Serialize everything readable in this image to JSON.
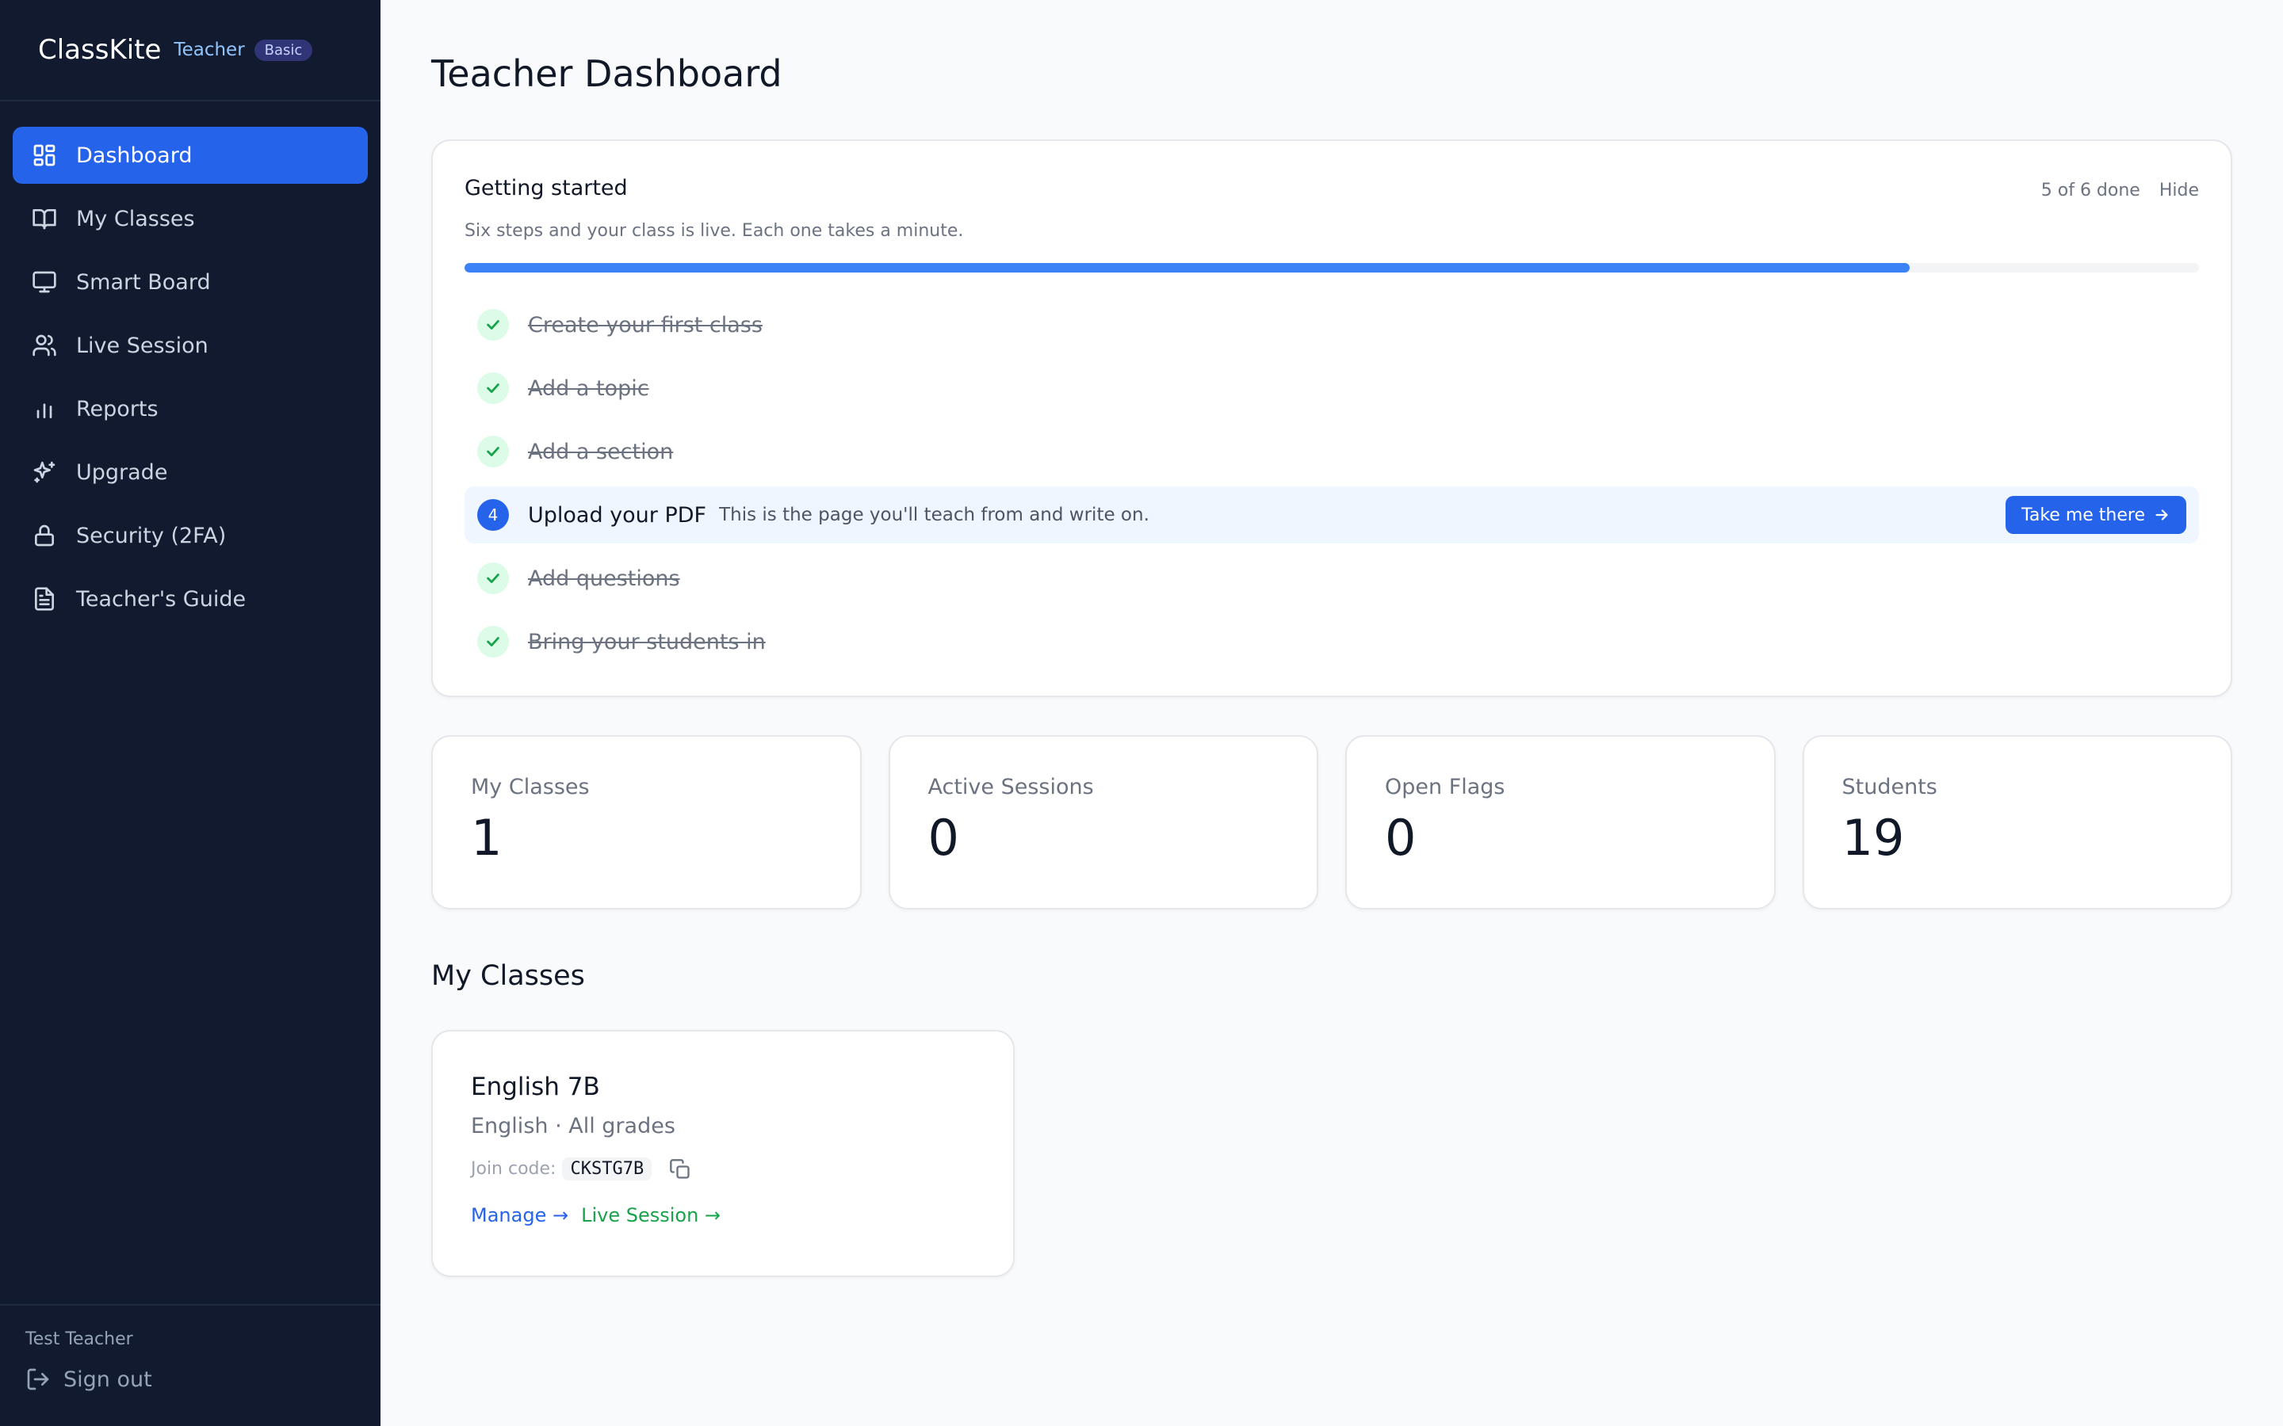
{
  "brand": {
    "name": "ClassKite",
    "role": "Teacher",
    "plan": "Basic"
  },
  "sidebar": {
    "items": [
      {
        "label": "Dashboard",
        "icon": "dashboard-icon",
        "active": true
      },
      {
        "label": "My Classes",
        "icon": "book-open-icon"
      },
      {
        "label": "Smart Board",
        "icon": "monitor-icon"
      },
      {
        "label": "Live Session",
        "icon": "users-icon"
      },
      {
        "label": "Reports",
        "icon": "bar-chart-icon"
      },
      {
        "label": "Upgrade",
        "icon": "sparkles-icon"
      },
      {
        "label": "Security (2FA)",
        "icon": "lock-icon"
      },
      {
        "label": "Teacher's Guide",
        "icon": "file-text-icon"
      }
    ],
    "user_name": "Test Teacher",
    "signout_label": "Sign out"
  },
  "page": {
    "title": "Teacher Dashboard"
  },
  "getting_started": {
    "title": "Getting started",
    "subtitle": "Six steps and your class is live. Each one takes a minute.",
    "progress_text": "5 of 6 done",
    "progress_fraction": 0.8333,
    "hide_label": "Hide",
    "steps": [
      {
        "label": "Create your first class",
        "done": true
      },
      {
        "label": "Add a topic",
        "done": true
      },
      {
        "label": "Add a section",
        "done": true
      },
      {
        "label": "Upload your PDF",
        "done": false,
        "number": "4",
        "description": "This is the page you'll teach from and write on.",
        "action_label": "Take me there"
      },
      {
        "label": "Add questions",
        "done": true
      },
      {
        "label": "Bring your students in",
        "done": true
      }
    ]
  },
  "stats": [
    {
      "label": "My Classes",
      "value": "1"
    },
    {
      "label": "Active Sessions",
      "value": "0"
    },
    {
      "label": "Open Flags",
      "value": "0"
    },
    {
      "label": "Students",
      "value": "19"
    }
  ],
  "my_classes": {
    "title": "My Classes",
    "classes": [
      {
        "name": "English 7B",
        "meta": "English · All grades",
        "join_label": "Join code:",
        "join_code": "CKSTG7B",
        "manage_label": "Manage →",
        "live_label": "Live Session →"
      }
    ]
  },
  "colors": {
    "sidebar_bg": "#111a2e",
    "accent": "#2563eb",
    "success": "#16a34a"
  }
}
